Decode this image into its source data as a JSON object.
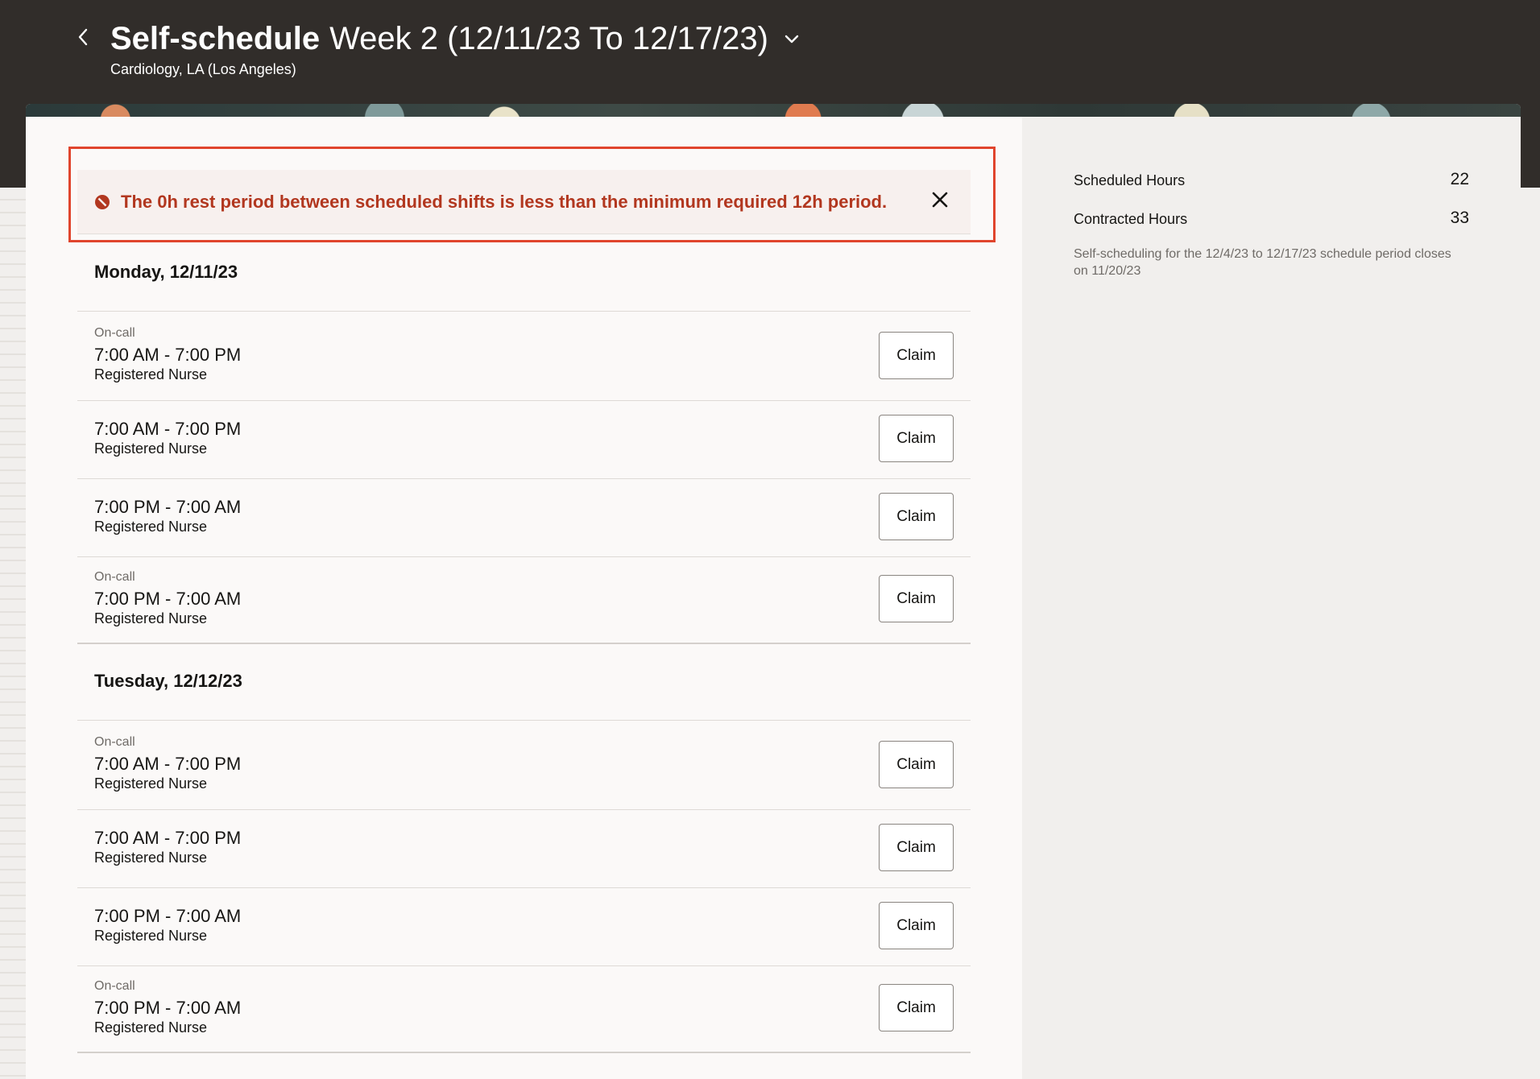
{
  "header": {
    "title_strong": "Self-schedule",
    "title_week": "Week 2 (12/11/23 To 12/17/23)",
    "subtitle": "Cardiology, LA (Los Angeles)"
  },
  "alert": {
    "message": "The 0h rest period between scheduled shifts is less than the minimum required 12h period."
  },
  "days": [
    {
      "heading": "Monday, 12/11/23",
      "shifts": [
        {
          "tag": "On-call",
          "time": "7:00 AM - 7:00 PM",
          "role": "Registered Nurse",
          "action": "Claim"
        },
        {
          "tag": "",
          "time": "7:00 AM - 7:00 PM",
          "role": "Registered Nurse",
          "action": "Claim"
        },
        {
          "tag": "",
          "time": "7:00 PM - 7:00 AM",
          "role": "Registered Nurse",
          "action": "Claim"
        },
        {
          "tag": "On-call",
          "time": "7:00 PM - 7:00 AM",
          "role": "Registered Nurse",
          "action": "Claim"
        }
      ]
    },
    {
      "heading": "Tuesday, 12/12/23",
      "shifts": [
        {
          "tag": "On-call",
          "time": "7:00 AM - 7:00 PM",
          "role": "Registered Nurse",
          "action": "Claim"
        },
        {
          "tag": "",
          "time": "7:00 AM - 7:00 PM",
          "role": "Registered Nurse",
          "action": "Claim"
        },
        {
          "tag": "",
          "time": "7:00 PM - 7:00 AM",
          "role": "Registered Nurse",
          "action": "Claim"
        },
        {
          "tag": "On-call",
          "time": "7:00 PM - 7:00 AM",
          "role": "Registered Nurse",
          "action": "Claim"
        }
      ]
    }
  ],
  "summary": {
    "scheduled_label": "Scheduled Hours",
    "scheduled_value": "22",
    "contracted_label": "Contracted Hours",
    "contracted_value": "33",
    "period_note": "Self-scheduling for the 12/4/23 to 12/17/23 schedule period closes on 11/20/23"
  },
  "colors": {
    "header_bg": "#312d2a",
    "error_text": "#b2371f",
    "error_border": "#e0452d"
  },
  "icons": {
    "back": "chevron-left-icon",
    "title_menu": "chevron-down-icon",
    "alert": "error-icon",
    "close": "close-icon"
  }
}
